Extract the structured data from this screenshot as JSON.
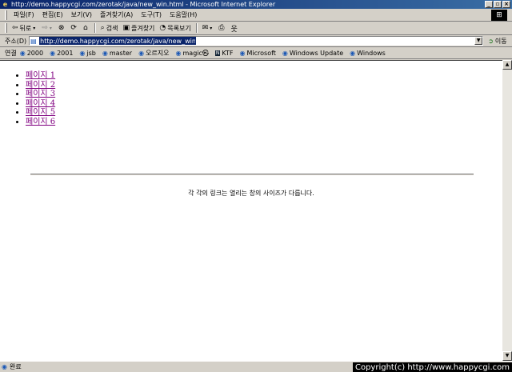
{
  "window": {
    "title": "http://demo.happycgi.com/zerotak/java/new_win.html - Microsoft Internet Explorer",
    "buttons": [
      "_",
      "▫",
      "×"
    ]
  },
  "menu": [
    "파일(F)",
    "편집(E)",
    "보기(V)",
    "즐겨찾기(A)",
    "도구(T)",
    "도움말(H)"
  ],
  "toolbar": {
    "back": "뒤로",
    "search": "검색",
    "favorites": "즐겨찾기",
    "history": "목록보기"
  },
  "address": {
    "label": "주소(D)",
    "value": "http://demo.happycgi.com/zerotak/java/new_win.html",
    "go": "이동"
  },
  "links": {
    "label": "연결",
    "items": [
      "2000",
      "2001",
      "jsb",
      "master",
      "오르지오",
      "magic㉿",
      "KTF",
      "Microsoft",
      "Windows Update",
      "Windows"
    ]
  },
  "content": {
    "pages": [
      "페이지 1",
      "페이지 2",
      "페이지 3",
      "페이지 4",
      "페이지 5",
      "페이지 6"
    ],
    "note": "각 각의 링크는 열리는 창의 사이즈가 다릅니다."
  },
  "status": {
    "text": "완료",
    "copyright": "Copyright(c) http://www.happycgi.com"
  }
}
